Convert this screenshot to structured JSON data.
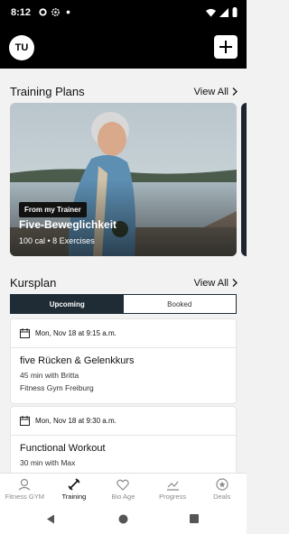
{
  "status_bar": {
    "time": "8:12"
  },
  "header": {
    "avatar_initials": "TU"
  },
  "training_plans": {
    "title": "Training Plans",
    "view_all": "View All",
    "card": {
      "badge": "From my Trainer",
      "title": "Five-Beweglichkeit",
      "meta": "100 cal • 8 Exercises"
    }
  },
  "kursplan": {
    "title": "Kursplan",
    "view_all": "View All",
    "tabs": [
      {
        "label": "Upcoming",
        "active": true
      },
      {
        "label": "Booked",
        "active": false
      }
    ],
    "courses": [
      {
        "date": "Mon, Nov 18 at 9:15 a.m.",
        "name": "five Rücken & Gelenkkurs",
        "duration": "45 min with Britta",
        "location": "Fitness Gym Freiburg"
      },
      {
        "date": "Mon, Nov 18 at 9:30 a.m.",
        "name": "Functional Workout",
        "duration": "30 min with Max",
        "location": ""
      }
    ]
  },
  "bottom_nav": [
    {
      "label": "Fitness GYM",
      "icon": "location-pin-icon",
      "active": false
    },
    {
      "label": "Training",
      "icon": "dumbbell-icon",
      "active": true
    },
    {
      "label": "Bio Age",
      "icon": "heart-icon",
      "active": false
    },
    {
      "label": "Progress",
      "icon": "chart-icon",
      "active": false
    },
    {
      "label": "Deals",
      "icon": "badge-icon",
      "active": false
    }
  ],
  "colors": {
    "accent": "#1f2c35",
    "header_bg": "#000000",
    "page_bg": "#f2f2f2"
  }
}
